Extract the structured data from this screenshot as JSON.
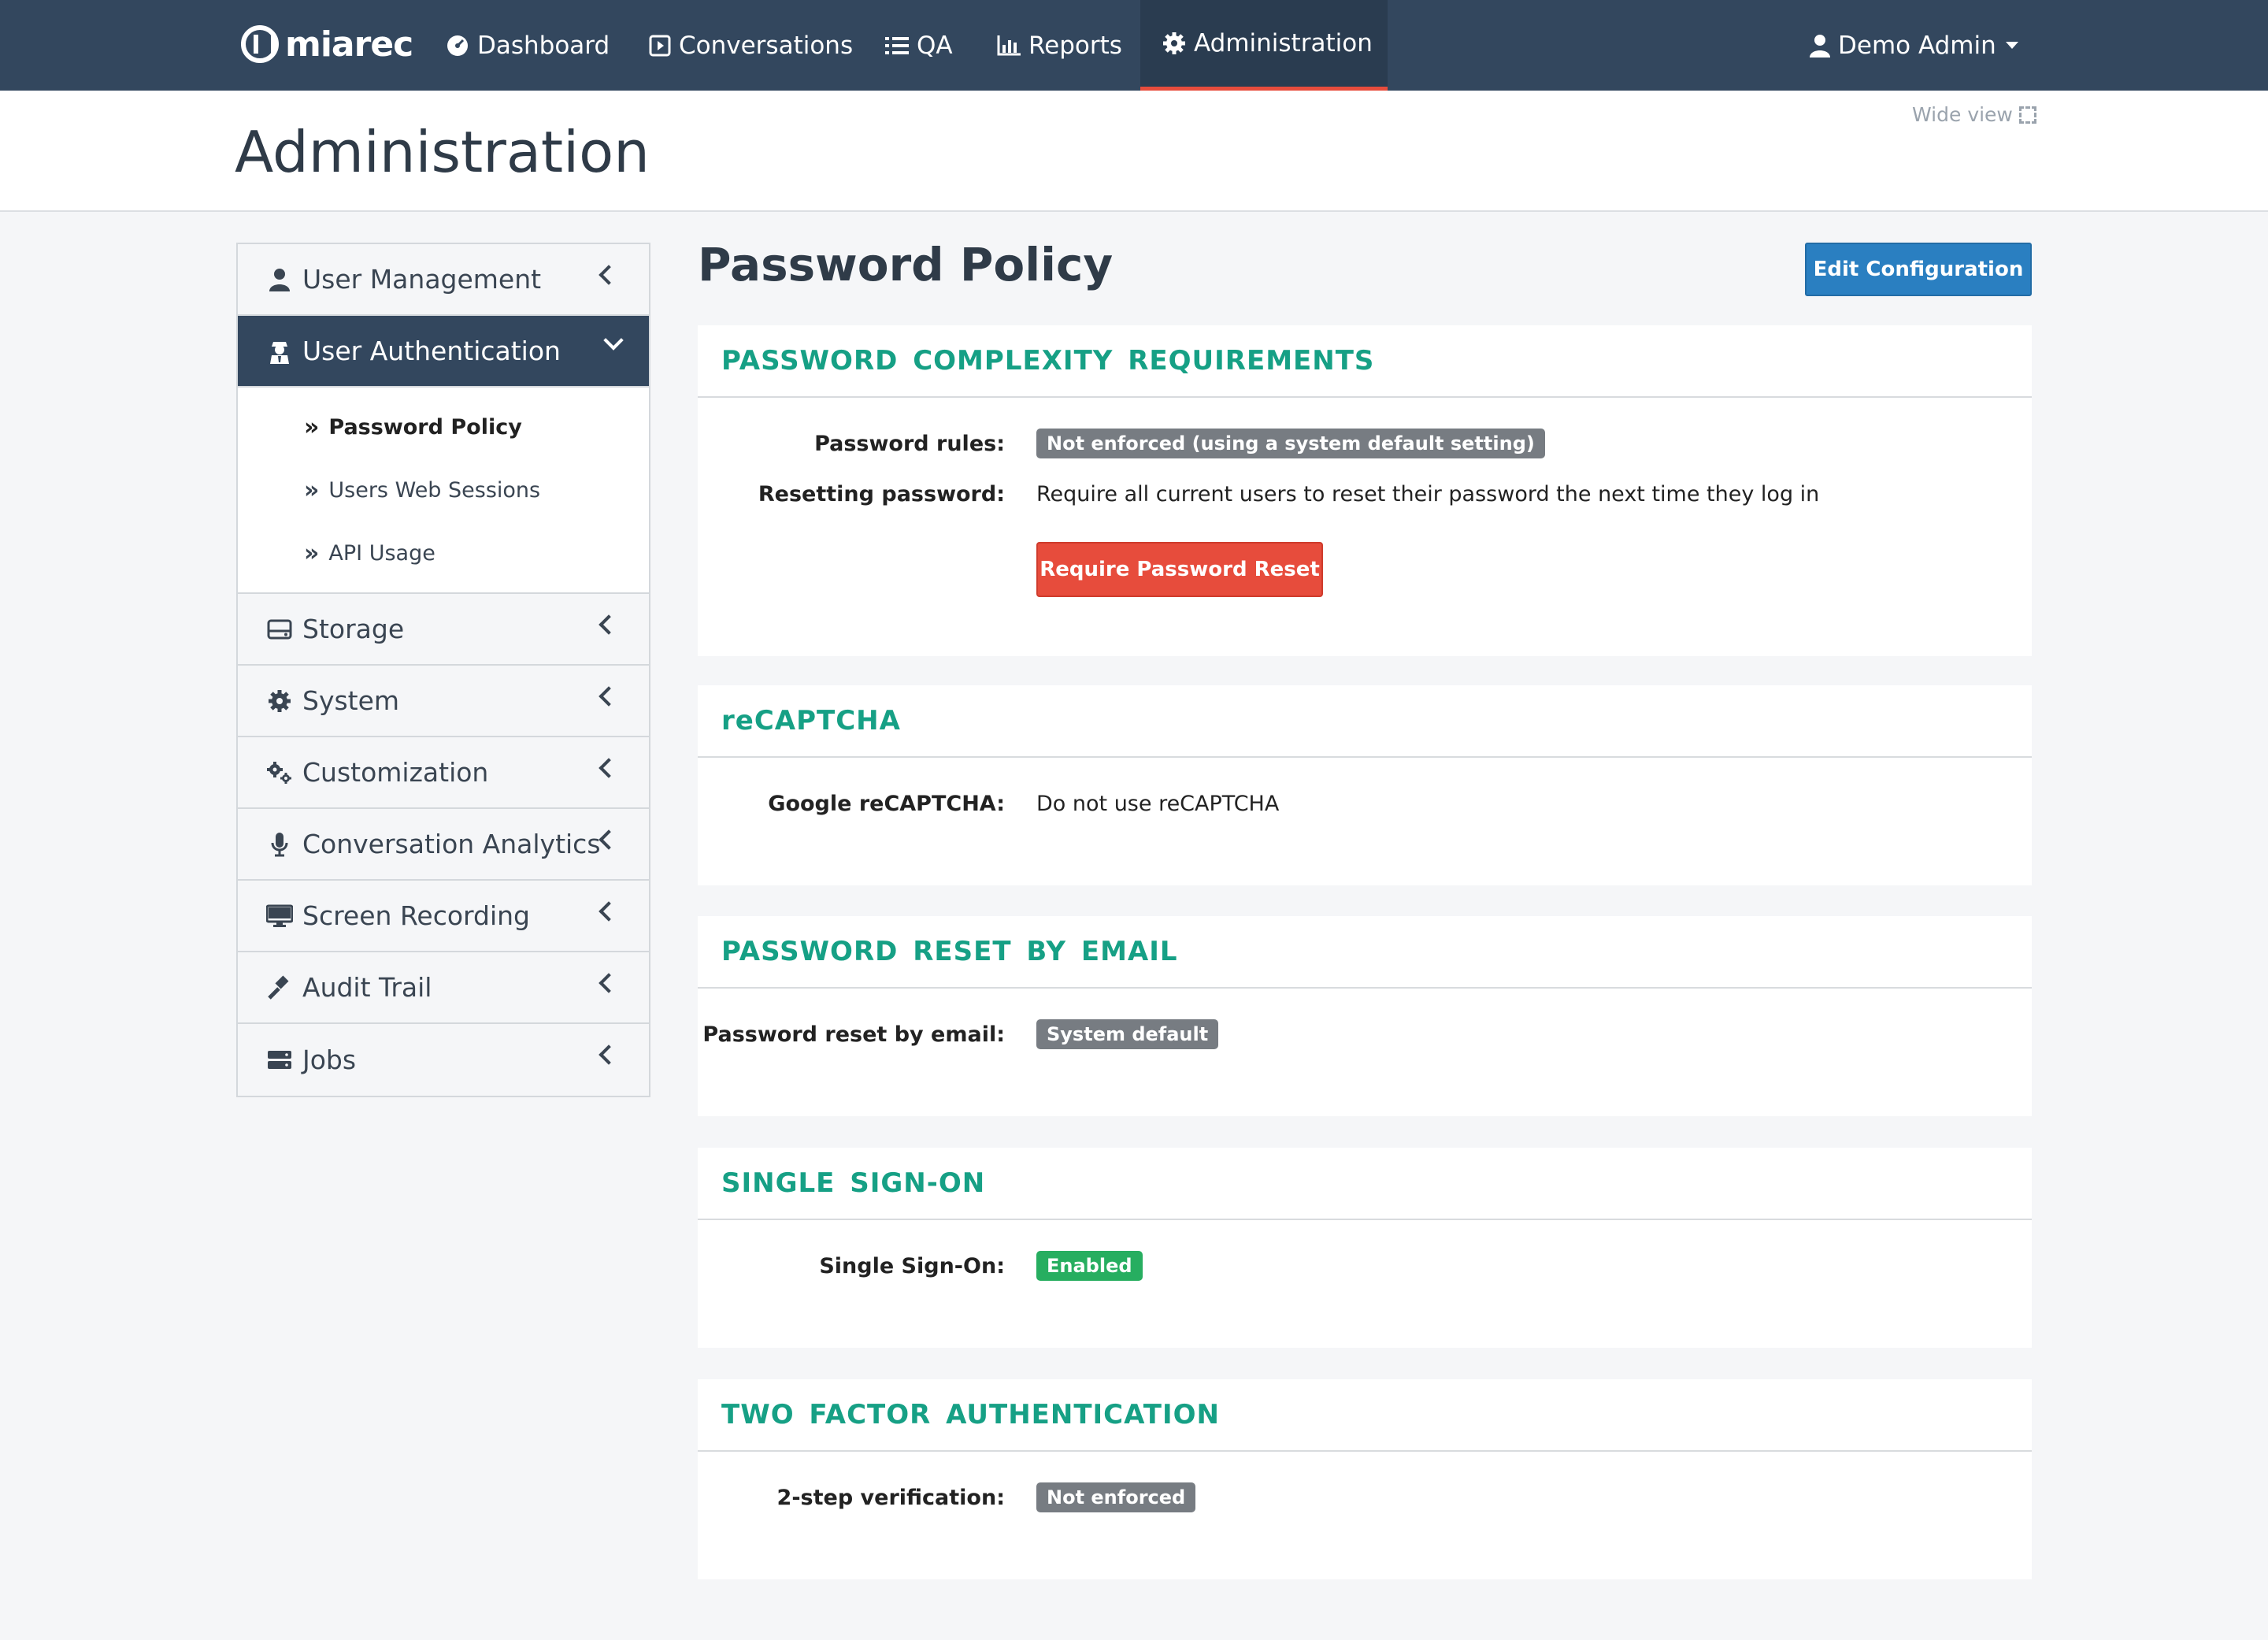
{
  "nav": {
    "brand": "miarec",
    "items": [
      {
        "label": "Dashboard",
        "icon": "dashboard-icon"
      },
      {
        "label": "Conversations",
        "icon": "play-square-icon"
      },
      {
        "label": "QA",
        "icon": "list-icon"
      },
      {
        "label": "Reports",
        "icon": "bar-chart-icon"
      },
      {
        "label": "Administration",
        "icon": "gear-icon"
      }
    ],
    "user": "Demo Admin",
    "active_index": 4
  },
  "header": {
    "title": "Administration",
    "wide_view": "Wide view"
  },
  "sidebar": {
    "items": [
      {
        "label": "User Management",
        "icon": "user-icon"
      },
      {
        "label": "User Authentication",
        "icon": "user-secret-icon"
      },
      {
        "label": "Storage",
        "icon": "hdd-icon"
      },
      {
        "label": "System",
        "icon": "gear-icon"
      },
      {
        "label": "Customization",
        "icon": "gears-icon"
      },
      {
        "label": "Conversation Analytics",
        "icon": "microphone-icon"
      },
      {
        "label": "Screen Recording",
        "icon": "desktop-icon"
      },
      {
        "label": "Audit Trail",
        "icon": "gavel-icon"
      },
      {
        "label": "Jobs",
        "icon": "server-icon"
      }
    ],
    "sub_items": [
      {
        "label": "Password Policy"
      },
      {
        "label": "Users Web Sessions"
      },
      {
        "label": "API Usage"
      }
    ]
  },
  "main": {
    "title": "Password Policy",
    "edit_button": "Edit Configuration",
    "sections": {
      "complexity": {
        "title": "Password complexity requirements",
        "rules_label": "Password rules:",
        "rules_value": "Not enforced (using a system default setting)",
        "reset_label": "Resetting password:",
        "reset_value": "Require all current users to reset their password the next time they log in",
        "reset_button": "Require Password Reset"
      },
      "recaptcha": {
        "title": "reCAPTCHA",
        "label": "Google reCAPTCHA:",
        "value": "Do not use reCAPTCHA"
      },
      "reset_email": {
        "title": "Password reset by email",
        "label": "Password reset by email:",
        "value": "System default"
      },
      "sso": {
        "title": "Single Sign-On",
        "label": "Single Sign-On:",
        "value": "Enabled"
      },
      "twofa": {
        "title": "Two factor authentication",
        "label": "2-step verification:",
        "value": "Not enforced"
      }
    }
  },
  "colors": {
    "navbar": "#33475e",
    "accent_teal": "#16a085",
    "primary_button": "#2a7fc1",
    "danger_button": "#e74c3c",
    "badge_gray": "#777c82",
    "badge_green": "#27ae60"
  }
}
